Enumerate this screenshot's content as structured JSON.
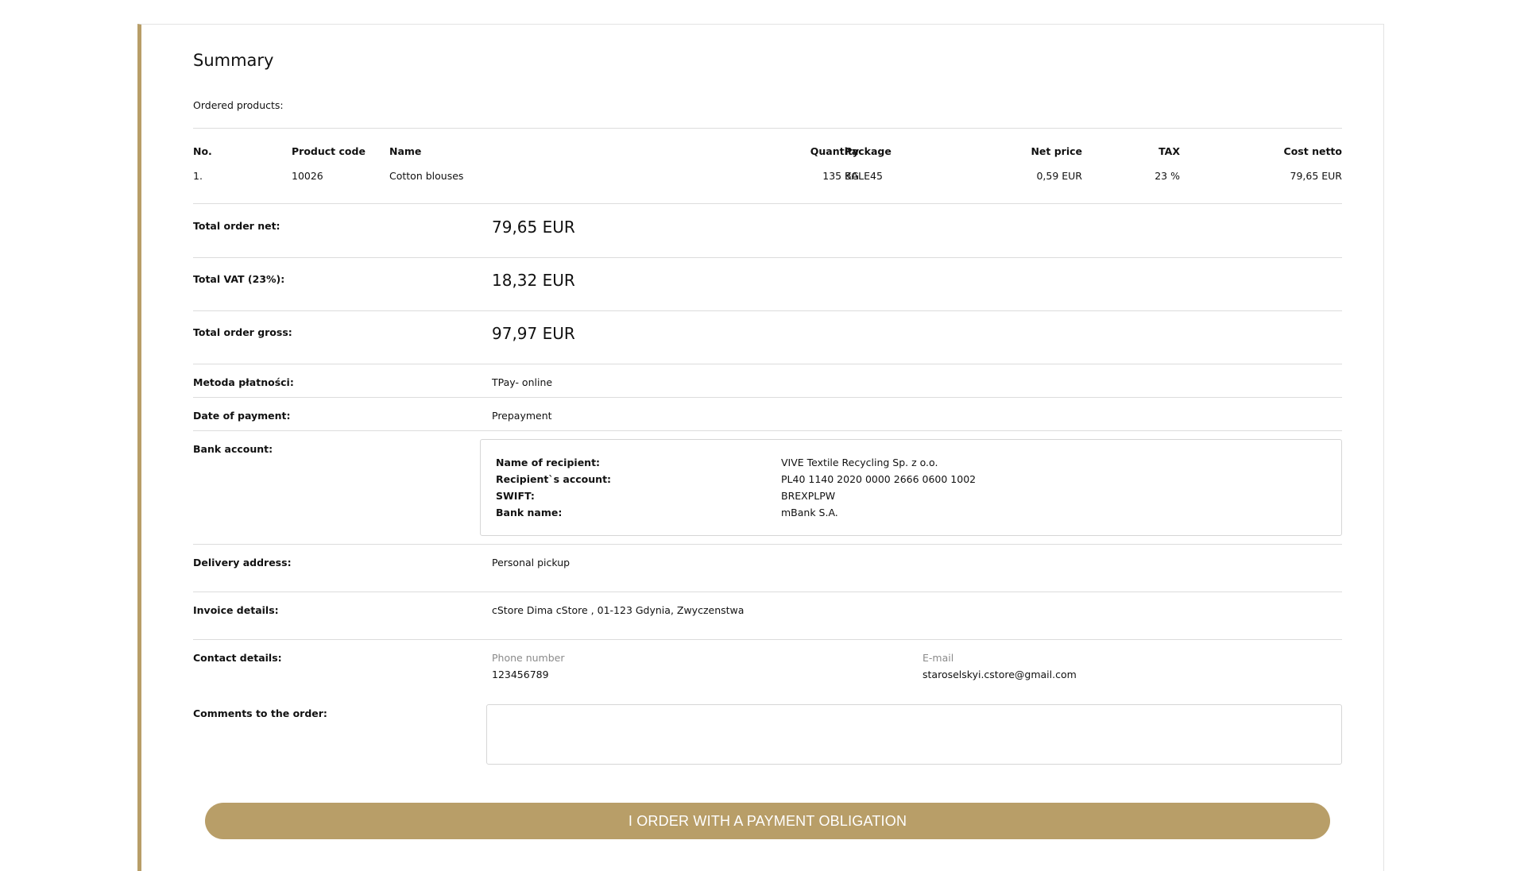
{
  "summary": {
    "title": "Summary",
    "ordered_products_label": "Ordered products:"
  },
  "products_table": {
    "headers": {
      "no": "No.",
      "product_code": "Product code",
      "name": "Name",
      "quantity": "Quantity",
      "package": "Package",
      "net_price": "Net price",
      "tax": "TAX",
      "cost_netto": "Cost netto"
    },
    "rows": [
      {
        "no": "1.",
        "product_code": "10026",
        "name": "Cotton blouses",
        "quantity": "135 KG",
        "package": "BALE45",
        "net_price": "0,59 EUR",
        "tax": "23 %",
        "cost_netto": "79,65 EUR"
      }
    ]
  },
  "totals": {
    "net_label": "Total order net:",
    "net_value": "79,65 EUR",
    "vat_label": "Total VAT (23%):",
    "vat_value": "18,32 EUR",
    "gross_label": "Total order gross:",
    "gross_value": "97,97 EUR"
  },
  "payment": {
    "method_label": "Metoda płatności:",
    "method_value": "TPay- online",
    "date_label": "Date of payment:",
    "date_value": "Prepayment"
  },
  "bank": {
    "label": "Bank account:",
    "recipient_label": "Name of recipient:",
    "recipient_value": "VIVE Textile Recycling Sp. z o.o.",
    "account_label": "Recipient`s account:",
    "account_value": "PL40 1140 2020 0000 2666 0600 1002",
    "swift_label": "SWIFT:",
    "swift_value": "BREXPLPW",
    "bank_name_label": "Bank name:",
    "bank_name_value": "mBank S.A."
  },
  "delivery": {
    "label": "Delivery address:",
    "value": "Personal pickup"
  },
  "invoice": {
    "label": "Invoice details:",
    "value": "cStore Dima cStore , 01-123 Gdynia, Zwyczenstwa"
  },
  "contact": {
    "label": "Contact details:",
    "phone_label": "Phone number",
    "phone_value": "123456789",
    "email_label": "E-mail",
    "email_value": "staroselskyi.cstore@gmail.com"
  },
  "comments": {
    "label": "Comments to the order:",
    "value": ""
  },
  "actions": {
    "order_button": "I ORDER WITH A PAYMENT OBLIGATION"
  },
  "colors": {
    "accent": "#b89e68",
    "border": "#dcdcdc"
  }
}
